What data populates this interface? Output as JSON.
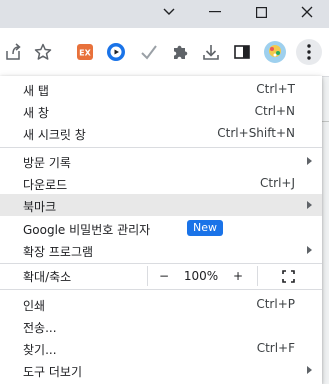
{
  "colors": {
    "titlebar": "#dee1e6",
    "accent": "#1a73e8",
    "highlight": "#e8e8e8"
  },
  "window_controls": [
    "chevron-down-icon",
    "minimize-icon",
    "maximize-icon",
    "close-icon"
  ],
  "toolbar": {
    "icons": [
      "share-icon",
      "bookmark-star-icon",
      "extension-ex-icon",
      "extension-play-icon",
      "extension-check-icon",
      "extensions-puzzle-icon",
      "download-icon",
      "side-panel-icon",
      "profile-avatar",
      "more-menu-icon"
    ]
  },
  "menu": {
    "new_tab": {
      "label": "새 탭",
      "shortcut": "Ctrl+T"
    },
    "new_window": {
      "label": "새 창",
      "shortcut": "Ctrl+N"
    },
    "incognito": {
      "label": "새 시크릿 창",
      "shortcut": "Ctrl+Shift+N"
    },
    "history": {
      "label": "방문 기록"
    },
    "downloads": {
      "label": "다운로드",
      "shortcut": "Ctrl+J"
    },
    "bookmarks": {
      "label": "북마크"
    },
    "password_manager": {
      "label": "Google 비밀번호 관리자",
      "badge": "New"
    },
    "extensions": {
      "label": "확장 프로그램"
    },
    "zoom": {
      "label": "확대/축소",
      "minus": "−",
      "value": "100%",
      "plus": "+"
    },
    "print": {
      "label": "인쇄",
      "shortcut": "Ctrl+P"
    },
    "cast": {
      "label": "전송..."
    },
    "find": {
      "label": "찾기...",
      "shortcut": "Ctrl+F"
    },
    "more_tools": {
      "label": "도구 더보기"
    }
  }
}
